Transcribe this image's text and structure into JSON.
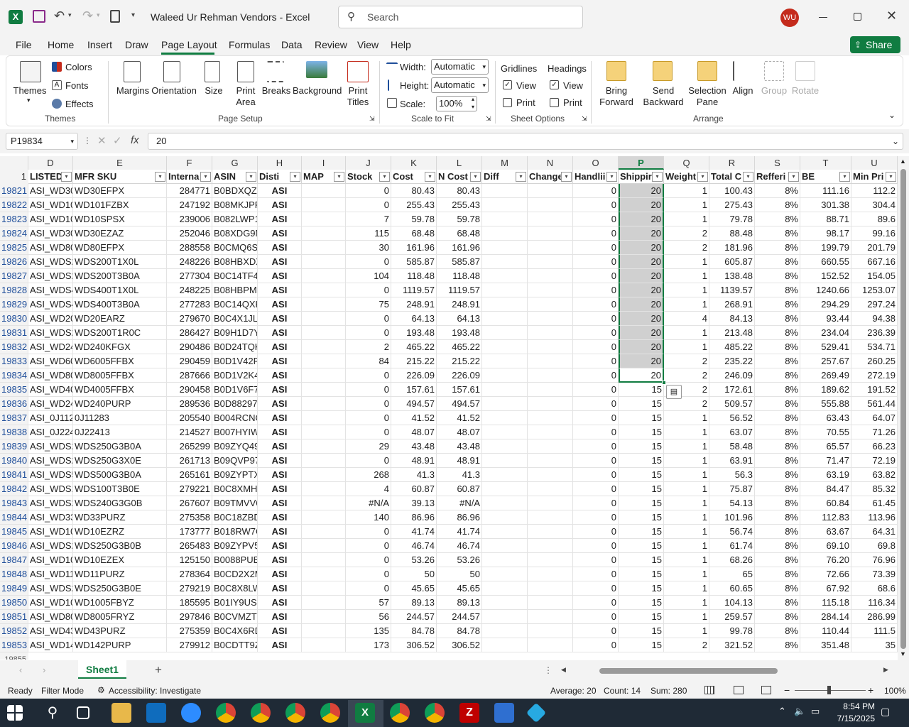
{
  "window": {
    "title": "Waleed Ur Rehman Vendors  -  Excel",
    "search_placeholder": "Search",
    "avatar": "WU"
  },
  "menu": [
    "File",
    "Home",
    "Insert",
    "Draw",
    "Page Layout",
    "Formulas",
    "Data",
    "Review",
    "View",
    "Help"
  ],
  "share_label": "Share",
  "ribbon": {
    "themes": {
      "themes": "Themes",
      "colors": "Colors",
      "fonts": "Fonts",
      "effects": "Effects",
      "group": "Themes"
    },
    "page_setup": {
      "margins": "Margins",
      "orientation": "Orientation",
      "size": "Size",
      "print_area": "Print Area",
      "breaks": "Breaks",
      "background": "Background",
      "print_titles": "Print Titles",
      "group": "Page Setup"
    },
    "scale": {
      "width_label": "Width:",
      "width_value": "Automatic",
      "height_label": "Height:",
      "height_value": "Automatic",
      "scale_label": "Scale:",
      "scale_value": "100%",
      "group": "Scale to Fit"
    },
    "sheet_options": {
      "gridlines": "Gridlines",
      "headings": "Headings",
      "view": "View",
      "print": "Print",
      "group": "Sheet Options"
    },
    "arrange": {
      "bring_forward": "Bring Forward",
      "send_backward": "Send Backward",
      "selection_pane": "Selection Pane",
      "align": "Align",
      "group_btn": "Group",
      "rotate": "Rotate",
      "group": "Arrange"
    }
  },
  "formula_bar": {
    "name_box": "P19834",
    "fx": "fx",
    "value": "20"
  },
  "columns": [
    "D",
    "E",
    "F",
    "G",
    "H",
    "I",
    "J",
    "K",
    "L",
    "M",
    "N",
    "O",
    "P",
    "Q",
    "R",
    "S",
    "T",
    "U"
  ],
  "header_row_num": "1",
  "headers": [
    "LISTED",
    "MFR SKU",
    "Interna",
    "ASIN",
    "Disti",
    "MAP",
    "Stock",
    "Cost",
    "N Cost",
    "Diff",
    "Change",
    "Handlii",
    "Shippir",
    "Weight",
    "Total C",
    "Refferi",
    "BE",
    "Min Pri"
  ],
  "rows": [
    [
      "19821",
      "ASI_WD30",
      "WD30EFPX",
      "284771",
      "B0BDXQZ1",
      "ASI",
      "",
      "0",
      "80.43",
      "80.43",
      "",
      "",
      "0",
      "20",
      "1",
      "100.43",
      "8%",
      "111.16",
      "112.2"
    ],
    [
      "19822",
      "ASI_WD10",
      "WD101FZBX",
      "247192",
      "B08MKJPF",
      "ASI",
      "",
      "0",
      "255.43",
      "255.43",
      "",
      "",
      "0",
      "20",
      "1",
      "275.43",
      "8%",
      "301.38",
      "304.4"
    ],
    [
      "19823",
      "ASI_WD10",
      "WD10SPSX",
      "239006",
      "B082LWP1",
      "ASI",
      "",
      "7",
      "59.78",
      "59.78",
      "",
      "",
      "0",
      "20",
      "1",
      "79.78",
      "8%",
      "88.71",
      "89.6"
    ],
    [
      "19824",
      "ASI_WD30",
      "WD30EZAZ",
      "252046",
      "B08XDG9N",
      "ASI",
      "",
      "115",
      "68.48",
      "68.48",
      "",
      "",
      "0",
      "20",
      "2",
      "88.48",
      "8%",
      "98.17",
      "99.16"
    ],
    [
      "19825",
      "ASI_WD80",
      "WD80EFPX",
      "288558",
      "B0CMQ6SI",
      "ASI",
      "",
      "30",
      "161.96",
      "161.96",
      "",
      "",
      "0",
      "20",
      "2",
      "181.96",
      "8%",
      "199.79",
      "201.79"
    ],
    [
      "19826",
      "ASI_WDS2",
      "WDS200T1X0L",
      "248226",
      "B08HBXDX",
      "ASI",
      "",
      "0",
      "585.87",
      "585.87",
      "",
      "",
      "0",
      "20",
      "1",
      "605.87",
      "8%",
      "660.55",
      "667.16"
    ],
    [
      "19827",
      "ASI_WDS2",
      "WDS200T3B0A",
      "277304",
      "B0C14TF4",
      "ASI",
      "",
      "104",
      "118.48",
      "118.48",
      "",
      "",
      "0",
      "20",
      "1",
      "138.48",
      "8%",
      "152.52",
      "154.05"
    ],
    [
      "19828",
      "ASI_WDS4",
      "WDS400T1X0L",
      "248225",
      "B08HBPMI",
      "ASI",
      "",
      "0",
      "1119.57",
      "1119.57",
      "",
      "",
      "0",
      "20",
      "1",
      "1139.57",
      "8%",
      "1240.66",
      "1253.07"
    ],
    [
      "19829",
      "ASI_WDS4",
      "WDS400T3B0A",
      "277283",
      "B0C14QXK",
      "ASI",
      "",
      "75",
      "248.91",
      "248.91",
      "",
      "",
      "0",
      "20",
      "1",
      "268.91",
      "8%",
      "294.29",
      "297.24"
    ],
    [
      "19830",
      "ASI_WD20",
      "WD20EARZ",
      "279670",
      "B0C4X1JL",
      "ASI",
      "",
      "0",
      "64.13",
      "64.13",
      "",
      "",
      "0",
      "20",
      "4",
      "84.13",
      "8%",
      "93.44",
      "94.38"
    ],
    [
      "19831",
      "ASI_WDS2",
      "WDS200T1R0C",
      "286427",
      "B09H1D7Y",
      "ASI",
      "",
      "0",
      "193.48",
      "193.48",
      "",
      "",
      "0",
      "20",
      "1",
      "213.48",
      "8%",
      "234.04",
      "236.39"
    ],
    [
      "19832",
      "ASI_WD24",
      "WD240KFGX",
      "290486",
      "B0D24TQK",
      "ASI",
      "",
      "2",
      "465.22",
      "465.22",
      "",
      "",
      "0",
      "20",
      "1",
      "485.22",
      "8%",
      "529.41",
      "534.71"
    ],
    [
      "19833",
      "ASI_WD60",
      "WD6005FFBX",
      "290459",
      "B0D1V42F",
      "ASI",
      "",
      "84",
      "215.22",
      "215.22",
      "",
      "",
      "0",
      "20",
      "2",
      "235.22",
      "8%",
      "257.67",
      "260.25"
    ],
    [
      "19834",
      "ASI_WD80",
      "WD8005FFBX",
      "287666",
      "B0D1V2K4",
      "ASI",
      "",
      "0",
      "226.09",
      "226.09",
      "",
      "",
      "0",
      "20",
      "2",
      "246.09",
      "8%",
      "269.49",
      "272.19"
    ],
    [
      "19835",
      "ASI_WD40",
      "WD4005FFBX",
      "290458",
      "B0D1V6F7",
      "ASI",
      "",
      "0",
      "157.61",
      "157.61",
      "",
      "",
      "0",
      "15",
      "2",
      "172.61",
      "8%",
      "189.62",
      "191.52"
    ],
    [
      "19836",
      "ASI_WD24",
      "WD240PURP",
      "289536",
      "B0D88297",
      "ASI",
      "",
      "0",
      "494.57",
      "494.57",
      "",
      "",
      "0",
      "15",
      "2",
      "509.57",
      "8%",
      "555.88",
      "561.44"
    ],
    [
      "19837",
      "ASI_0J112",
      "0J11283",
      "205540",
      "B004RCNC",
      "ASI",
      "",
      "0",
      "41.52",
      "41.52",
      "",
      "",
      "0",
      "15",
      "1",
      "56.52",
      "8%",
      "63.43",
      "64.07"
    ],
    [
      "19838",
      "ASI_0J224",
      "0J22413",
      "214527",
      "B007HYIW",
      "ASI",
      "",
      "0",
      "48.07",
      "48.07",
      "",
      "",
      "0",
      "15",
      "1",
      "63.07",
      "8%",
      "70.55",
      "71.26"
    ],
    [
      "19839",
      "ASI_WDS2",
      "WDS250G3B0A",
      "265299",
      "B09ZYQ49",
      "ASI",
      "",
      "29",
      "43.48",
      "43.48",
      "",
      "",
      "0",
      "15",
      "1",
      "58.48",
      "8%",
      "65.57",
      "66.23"
    ],
    [
      "19840",
      "ASI_WDS2",
      "WDS250G3X0E",
      "261713",
      "B09QVP97",
      "ASI",
      "",
      "0",
      "48.91",
      "48.91",
      "",
      "",
      "0",
      "15",
      "1",
      "63.91",
      "8%",
      "71.47",
      "72.19"
    ],
    [
      "19841",
      "ASI_WDS5",
      "WDS500G3B0A",
      "265161",
      "B09ZYPTX",
      "ASI",
      "",
      "268",
      "41.3",
      "41.3",
      "",
      "",
      "0",
      "15",
      "1",
      "56.3",
      "8%",
      "63.19",
      "63.82"
    ],
    [
      "19842",
      "ASI_WDS1",
      "WDS100T3B0E",
      "279221",
      "B0C8XMH2",
      "ASI",
      "",
      "4",
      "60.87",
      "60.87",
      "",
      "",
      "0",
      "15",
      "1",
      "75.87",
      "8%",
      "84.47",
      "85.32"
    ],
    [
      "19843",
      "ASI_WDS2",
      "WDS240G3G0B",
      "267607",
      "B09TMVV6",
      "ASI",
      "",
      "#N/A",
      "39.13",
      "#N/A",
      "",
      "",
      "0",
      "15",
      "1",
      "54.13",
      "8%",
      "60.84",
      "61.45"
    ],
    [
      "19844",
      "ASI_WD33",
      "WD33PURZ",
      "275358",
      "B0C18ZBD",
      "ASI",
      "",
      "140",
      "86.96",
      "86.96",
      "",
      "",
      "0",
      "15",
      "1",
      "101.96",
      "8%",
      "112.83",
      "113.96"
    ],
    [
      "19845",
      "ASI_WD10",
      "WD10EZRZ",
      "173777",
      "B018RW7C",
      "ASI",
      "",
      "0",
      "41.74",
      "41.74",
      "",
      "",
      "0",
      "15",
      "1",
      "56.74",
      "8%",
      "63.67",
      "64.31"
    ],
    [
      "19846",
      "ASI_WDS2",
      "WDS250G3B0B",
      "265483",
      "B09ZYPV5",
      "ASI",
      "",
      "0",
      "46.74",
      "46.74",
      "",
      "",
      "0",
      "15",
      "1",
      "61.74",
      "8%",
      "69.10",
      "69.8"
    ],
    [
      "19847",
      "ASI_WD10",
      "WD10EZEX",
      "125150",
      "B0088PUE",
      "ASI",
      "",
      "0",
      "53.26",
      "53.26",
      "",
      "",
      "0",
      "15",
      "1",
      "68.26",
      "8%",
      "76.20",
      "76.96"
    ],
    [
      "19848",
      "ASI_WD11",
      "WD11PURZ",
      "278364",
      "B0CD2X2M",
      "ASI",
      "",
      "0",
      "50",
      "50",
      "",
      "",
      "0",
      "15",
      "1",
      "65",
      "8%",
      "72.66",
      "73.39"
    ],
    [
      "19849",
      "ASI_WDS2",
      "WDS250G3B0E",
      "279219",
      "B0C8X8LW",
      "ASI",
      "",
      "0",
      "45.65",
      "45.65",
      "",
      "",
      "0",
      "15",
      "1",
      "60.65",
      "8%",
      "67.92",
      "68.6"
    ],
    [
      "19850",
      "ASI_WD10",
      "WD1005FBYZ",
      "185595",
      "B01IY9USY",
      "ASI",
      "",
      "57",
      "89.13",
      "89.13",
      "",
      "",
      "0",
      "15",
      "1",
      "104.13",
      "8%",
      "115.18",
      "116.34"
    ],
    [
      "19851",
      "ASI_WD80",
      "WD8005FRYZ",
      "297846",
      "B0CVMZTE",
      "ASI",
      "",
      "56",
      "244.57",
      "244.57",
      "",
      "",
      "0",
      "15",
      "1",
      "259.57",
      "8%",
      "284.14",
      "286.99"
    ],
    [
      "19852",
      "ASI_WD43",
      "WD43PURZ",
      "275359",
      "B0C4X6RD",
      "ASI",
      "",
      "135",
      "84.78",
      "84.78",
      "",
      "",
      "0",
      "15",
      "1",
      "99.78",
      "8%",
      "110.44",
      "111.5"
    ],
    [
      "19853",
      "ASI_WD14",
      "WD142PURP",
      "279912",
      "B0CDTT9Z",
      "ASI",
      "",
      "173",
      "306.52",
      "306.52",
      "",
      "",
      "0",
      "15",
      "2",
      "321.52",
      "8%",
      "351.48",
      "35"
    ]
  ],
  "partial_row": "19855",
  "sheet_tab": "Sheet1",
  "status": {
    "ready": "Ready",
    "filter_mode": "Filter Mode",
    "accessibility": "Accessibility: Investigate",
    "average": "Average: 20",
    "count": "Count: 14",
    "sum": "Sum: 280",
    "zoom": "100%"
  },
  "clock": {
    "time": "8:54 PM",
    "date": "7/15/2025"
  },
  "colors": {
    "excel_green": "#107c41",
    "accent_red": "#c42b1c",
    "selection": "#d0d0d0"
  }
}
